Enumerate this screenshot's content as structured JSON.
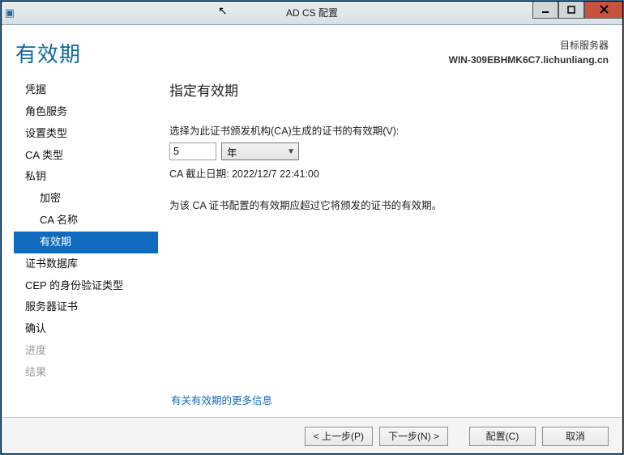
{
  "window": {
    "title": "AD CS 配置"
  },
  "header": {
    "page_title": "有效期",
    "target_label": "目标服务器",
    "target_host": "WIN-309EBHMK6C7.lichunliang.cn"
  },
  "sidebar": {
    "items": [
      {
        "label": "凭据",
        "sub": false,
        "selected": false,
        "disabled": false
      },
      {
        "label": "角色服务",
        "sub": false,
        "selected": false,
        "disabled": false
      },
      {
        "label": "设置类型",
        "sub": false,
        "selected": false,
        "disabled": false
      },
      {
        "label": "CA 类型",
        "sub": false,
        "selected": false,
        "disabled": false
      },
      {
        "label": "私钥",
        "sub": false,
        "selected": false,
        "disabled": false
      },
      {
        "label": "加密",
        "sub": true,
        "selected": false,
        "disabled": false
      },
      {
        "label": "CA 名称",
        "sub": true,
        "selected": false,
        "disabled": false
      },
      {
        "label": "有效期",
        "sub": true,
        "selected": true,
        "disabled": false
      },
      {
        "label": "证书数据库",
        "sub": false,
        "selected": false,
        "disabled": false
      },
      {
        "label": "CEP 的身份验证类型",
        "sub": false,
        "selected": false,
        "disabled": false
      },
      {
        "label": "服务器证书",
        "sub": false,
        "selected": false,
        "disabled": false
      },
      {
        "label": "确认",
        "sub": false,
        "selected": false,
        "disabled": false
      },
      {
        "label": "进度",
        "sub": false,
        "selected": false,
        "disabled": true
      },
      {
        "label": "结果",
        "sub": false,
        "selected": false,
        "disabled": true
      }
    ]
  },
  "main": {
    "heading": "指定有效期",
    "field_label": "选择为此证书颁发机构(CA)生成的证书的有效期(V):",
    "period_value": "5",
    "period_unit": "年",
    "expiry_line": "CA 截止日期: 2022/12/7 22:41:00",
    "hint": "为该 CA 证书配置的有效期应超过它将颁发的证书的有效期。",
    "more_link": "有关有效期的更多信息"
  },
  "buttons": {
    "prev": "< 上一步(P)",
    "next": "下一步(N) >",
    "configure": "配置(C)",
    "cancel": "取消"
  }
}
